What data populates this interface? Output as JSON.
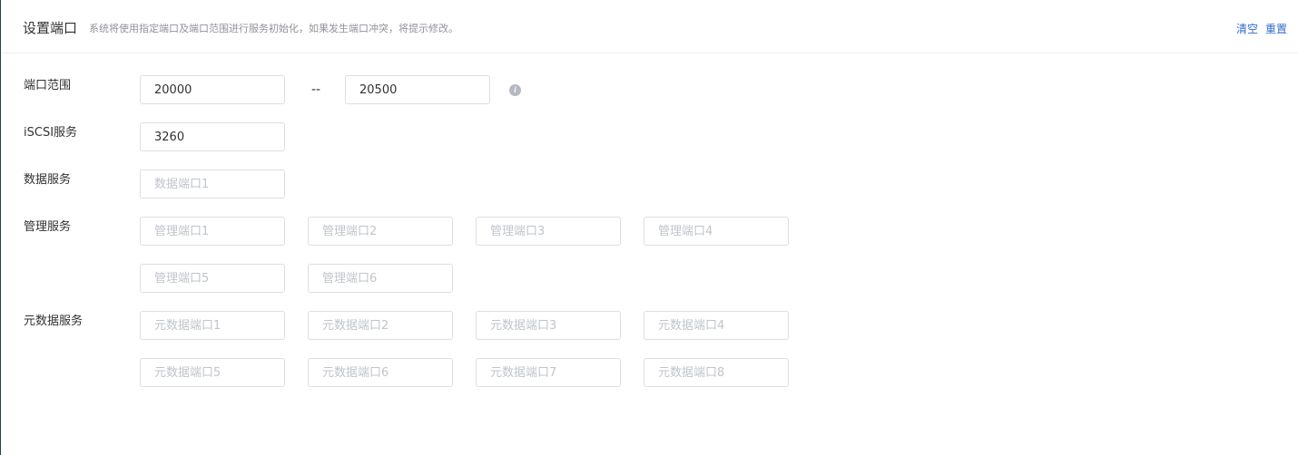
{
  "header": {
    "title": "设置端口",
    "description": "系统将使用指定端口及端口范围进行服务初始化，如果发生端口冲突，将提示修改。",
    "actions": {
      "clear": "清空",
      "reset": "重置"
    }
  },
  "port_range": {
    "label": "端口范围",
    "start_value": "20000",
    "separator": "--",
    "end_value": "20500",
    "info_icon": "i"
  },
  "iscsi": {
    "label": "iSCSI服务",
    "value": "3260"
  },
  "data_service": {
    "label": "数据服务",
    "ports": [
      {
        "value": "",
        "placeholder": "数据端口1"
      }
    ]
  },
  "management_service": {
    "label": "管理服务",
    "ports": [
      {
        "value": "",
        "placeholder": "管理端口1"
      },
      {
        "value": "",
        "placeholder": "管理端口2"
      },
      {
        "value": "",
        "placeholder": "管理端口3"
      },
      {
        "value": "",
        "placeholder": "管理端口4"
      },
      {
        "value": "",
        "placeholder": "管理端口5"
      },
      {
        "value": "",
        "placeholder": "管理端口6"
      }
    ]
  },
  "metadata_service": {
    "label": "元数据服务",
    "ports": [
      {
        "value": "",
        "placeholder": "元数据端口1"
      },
      {
        "value": "",
        "placeholder": "元数据端口2"
      },
      {
        "value": "",
        "placeholder": "元数据端口3"
      },
      {
        "value": "",
        "placeholder": "元数据端口4"
      },
      {
        "value": "",
        "placeholder": "元数据端口5"
      },
      {
        "value": "",
        "placeholder": "元数据端口6"
      },
      {
        "value": "",
        "placeholder": "元数据端口7"
      },
      {
        "value": "",
        "placeholder": "元数据端口8"
      }
    ]
  }
}
